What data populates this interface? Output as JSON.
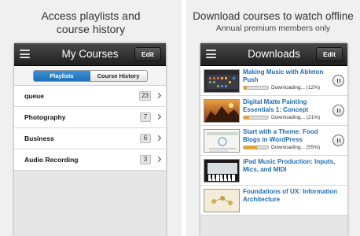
{
  "left": {
    "caption": "Access playlists and\ncourse history",
    "nav_title": "My Courses",
    "edit_label": "Edit",
    "tabs": [
      {
        "label": "Playlists",
        "active": true
      },
      {
        "label": "Course History",
        "active": false
      }
    ],
    "rows": [
      {
        "label": "queue",
        "count": "23"
      },
      {
        "label": "Photography",
        "count": "7"
      },
      {
        "label": "Business",
        "count": "6"
      },
      {
        "label": "Audio Recording",
        "count": "3"
      }
    ]
  },
  "right": {
    "caption": "Download courses to watch offline",
    "subcaption": "Annual premium members only",
    "nav_title": "Downloads",
    "edit_label": "Edit",
    "items": [
      {
        "title": "Making Music with Ableton Push",
        "status": "Downloading... (12%)",
        "progress": 0.12,
        "has_pause": true
      },
      {
        "title": "Digital Matte Painting Essentials 1: Concept",
        "status": "Downloading... (21%)",
        "progress": 0.21,
        "has_pause": true
      },
      {
        "title": "Start with a Theme: Food Blogs in WordPress",
        "status": "Downloading... (55%)",
        "progress": 0.55,
        "has_pause": true
      },
      {
        "title": "iPad Music Production: Inputs, Mics, and MIDI",
        "status": "",
        "progress": null,
        "has_pause": false
      },
      {
        "title": "Foundations of UX: Information Architecture",
        "status": "",
        "progress": null,
        "has_pause": false
      }
    ]
  },
  "colors": {
    "accent_blue": "#1d6cb5",
    "progress_orange": "#f0a01a",
    "navbar_dark": "#2a2a2a"
  }
}
